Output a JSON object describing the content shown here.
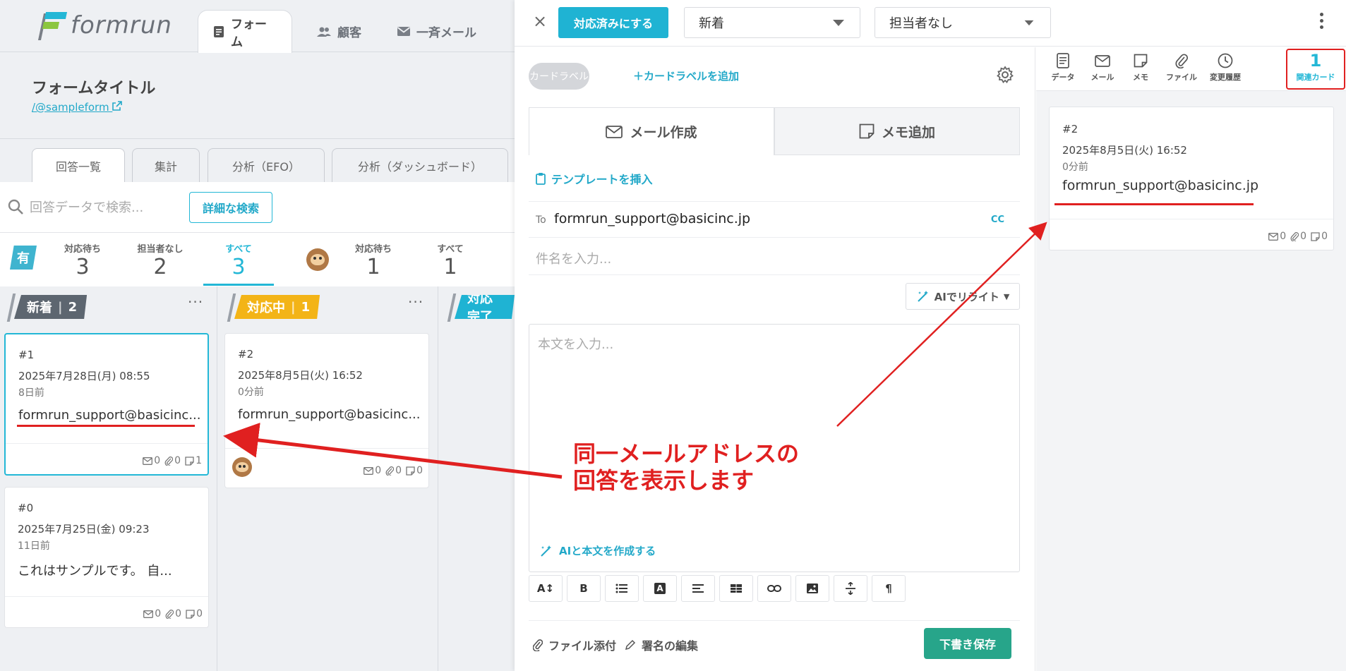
{
  "app": {
    "logo_text": "formrun",
    "tabs": [
      {
        "label": "フォーム",
        "icon": "form-icon",
        "active": true
      },
      {
        "label": "顧客",
        "icon": "users-icon",
        "active": false
      },
      {
        "label": "一斉メール",
        "icon": "mail-icon",
        "active": false
      }
    ]
  },
  "form": {
    "title": "フォームタイトル",
    "link": "/@sampleform"
  },
  "subtabs": [
    {
      "label": "回答一覧",
      "active": true
    },
    {
      "label": "集計",
      "active": false
    },
    {
      "label": "分析（EFO）",
      "active": false
    },
    {
      "label": "分析（ダッシュボード）",
      "active": false
    }
  ],
  "search": {
    "placeholder": "回答データで検索...",
    "advanced_label": "詳細な検索"
  },
  "stats": {
    "group_badge": "有",
    "items": [
      {
        "label": "対応待ち",
        "value": "3"
      },
      {
        "label": "担当者なし",
        "value": "2"
      },
      {
        "label": "すべて",
        "value": "3",
        "active": true
      },
      {
        "label": "対応待ち",
        "value": "1"
      },
      {
        "label": "すべて",
        "value": "1"
      }
    ]
  },
  "columns": [
    {
      "label": "新着",
      "count": "2",
      "color": "#5d6670"
    },
    {
      "label": "対応中",
      "count": "1",
      "color": "#f3b417"
    },
    {
      "label": "対応完了",
      "count": "",
      "color": "#1fb3d3"
    }
  ],
  "cards": [
    {
      "id": "#1",
      "date": "2025年7月28日(月) 08:55",
      "ago": "8日前",
      "title": "formrun_support@basicinc...",
      "mail": "0",
      "file": "0",
      "memo": "1"
    },
    {
      "id": "#0",
      "date": "2025年7月25日(金) 09:23",
      "ago": "11日前",
      "title": "これはサンプルです。 自...",
      "mail": "0",
      "file": "0",
      "memo": "0"
    },
    {
      "id": "#2",
      "date": "2025年8月5日(火) 16:52",
      "ago": "0分前",
      "title": "formrun_support@basicinc...",
      "mail": "0",
      "file": "0",
      "memo": "0"
    }
  ],
  "drawer": {
    "close": "×",
    "done_button": "対応済みにする",
    "status_select": "新着",
    "assignee_select": "担当者なし",
    "card_label": "カードラベル",
    "add_label": "＋カードラベルを追加",
    "tabs": [
      {
        "label": "メール作成",
        "active": true
      },
      {
        "label": "メモ追加",
        "active": false
      }
    ],
    "template_link": "テンプレートを挿入",
    "to_label": "To",
    "to_value": "formrun_support@basicinc.jp",
    "cc_label": "CC",
    "subject_placeholder": "件名を入力...",
    "ai_rewrite": "AIでリライト",
    "body_placeholder": "本文を入力...",
    "ai_compose": "AIと本文を作成する",
    "toolbar": [
      "A↕",
      "B",
      "list",
      "A",
      "align",
      "table",
      "link",
      "image",
      "hr",
      "¶"
    ],
    "attach_label": "ファイル添付",
    "signature_label": "署名の編集",
    "draft_button": "下書き保存"
  },
  "side_tabs": [
    {
      "label": "データ",
      "icon": "document-icon"
    },
    {
      "label": "メール",
      "icon": "mail-icon"
    },
    {
      "label": "メモ",
      "icon": "memo-icon"
    },
    {
      "label": "ファイル",
      "icon": "paperclip-icon"
    },
    {
      "label": "変更履歴",
      "icon": "clock-icon"
    },
    {
      "label": "関連カード",
      "count": "1"
    }
  ],
  "related_card": {
    "id": "#2",
    "date": "2025年8月5日(火) 16:52",
    "ago": "0分前",
    "email": "formrun_support@basicinc.jp",
    "mail": "0",
    "file": "0",
    "memo": "0"
  },
  "annotation": {
    "line1": "同一メールアドレスの",
    "line2": "回答を表示します",
    "color": "#e02020"
  },
  "colors": {
    "accent": "#1fb3d3",
    "draft_green": "#27a58a",
    "annotation_red": "#e02020"
  }
}
